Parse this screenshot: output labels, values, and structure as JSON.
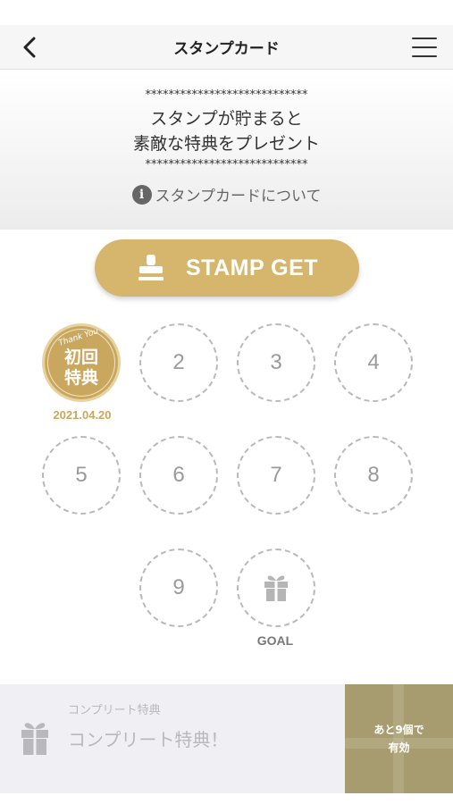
{
  "header": {
    "title": "スタンプカード",
    "back_icon": "chevron-left-icon",
    "menu_icon": "hamburger-menu-icon"
  },
  "banner": {
    "stars_top": "****************************",
    "message_line1": "スタンプが貯まると",
    "message_line2": "素敵な特典をプレゼント",
    "stars_bottom": "****************************",
    "about_link": "スタンプカードについて",
    "about_icon": "info-icon"
  },
  "stamp_get": {
    "label": "STAMP GET",
    "icon": "stamp-icon",
    "color": "#d6b66c"
  },
  "stamp_card": {
    "first_stamp": {
      "ribbon": "Thank You !",
      "line1": "初回",
      "line2": "特典",
      "date": "2021.04.20",
      "color": "#c9a75e"
    },
    "slots": [
      "2",
      "3",
      "4",
      "5",
      "6",
      "7",
      "8",
      "9"
    ],
    "goal_label": "GOAL",
    "goal_icon": "gift-icon"
  },
  "complete_reward": {
    "sub_label": "コンプリート特典",
    "title": "コンプリート特典！",
    "icon": "gift-icon",
    "remaining_line1": "あと9個で",
    "remaining_line2": "有効"
  }
}
